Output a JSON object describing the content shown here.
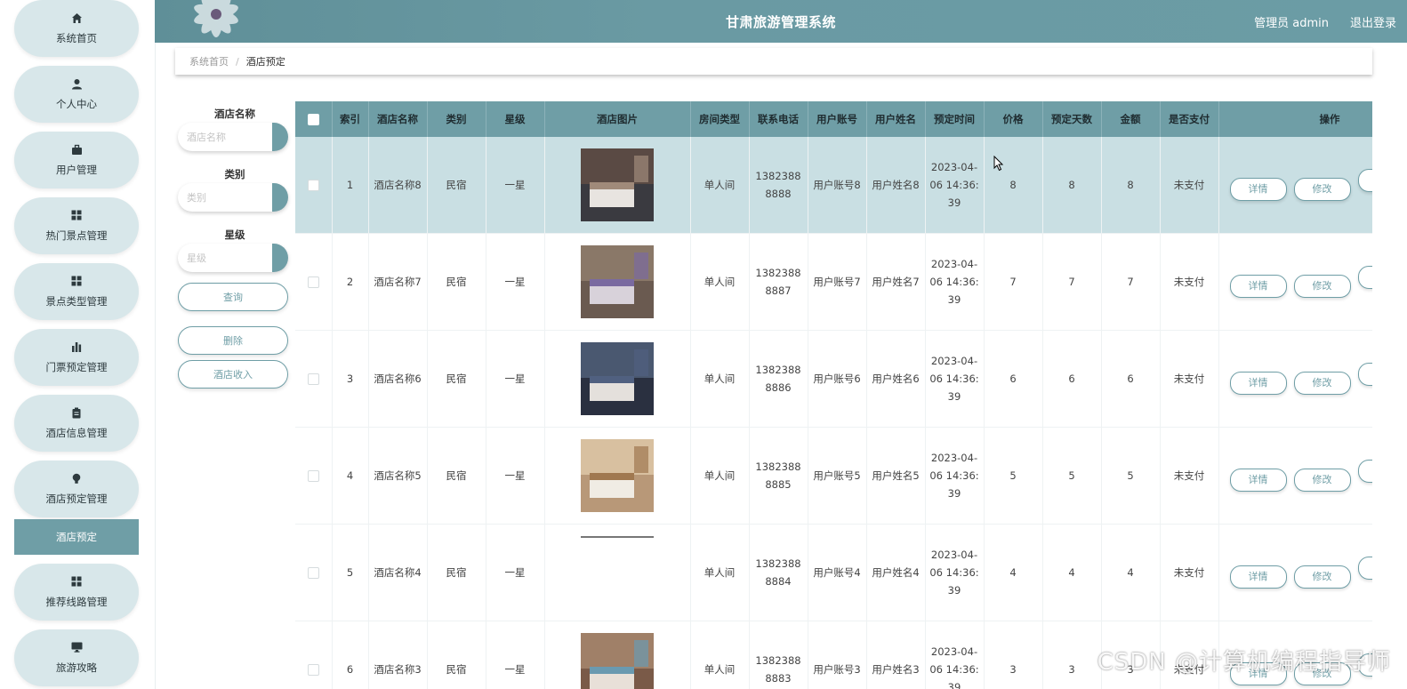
{
  "header": {
    "title": "甘肃旅游管理系统",
    "admin_text": "管理员 admin",
    "logout": "退出登录"
  },
  "sidebar": {
    "items": [
      {
        "label": "系统首页",
        "icon": "home-icon"
      },
      {
        "label": "个人中心",
        "icon": "user-icon"
      },
      {
        "label": "用户管理",
        "icon": "briefcase-icon"
      },
      {
        "label": "热门景点管理",
        "icon": "grid-icon"
      },
      {
        "label": "景点类型管理",
        "icon": "grid-icon"
      },
      {
        "label": "门票预定管理",
        "icon": "bar-chart-icon"
      },
      {
        "label": "酒店信息管理",
        "icon": "clipboard-icon"
      },
      {
        "label": "酒店预定管理",
        "icon": "bulb-icon"
      },
      {
        "label": "推荐线路管理",
        "icon": "grid-icon"
      },
      {
        "label": "旅游攻略",
        "icon": "monitor-icon"
      }
    ],
    "active_sub": "酒店预定"
  },
  "breadcrumb": {
    "home": "系统首页",
    "separator": "/",
    "current": "酒店预定"
  },
  "filter": {
    "name_label": "酒店名称",
    "name_placeholder": "酒店名称",
    "type_label": "类别",
    "type_placeholder": "类别",
    "star_label": "星级",
    "star_placeholder": "星级",
    "query_button": "查询",
    "delete_button": "删除",
    "income_button": "酒店收入"
  },
  "table": {
    "columns": [
      "索引",
      "酒店名称",
      "类别",
      "星级",
      "酒店图片",
      "房间类型",
      "联系电话",
      "用户账号",
      "用户姓名",
      "预定时间",
      "价格",
      "预定天数",
      "金额",
      "是否支付",
      "操作"
    ],
    "detail_label": "详情",
    "edit_label": "修改",
    "rows": [
      {
        "index": "1",
        "hotel_name": "酒店名称8",
        "category": "民宿",
        "star": "一星",
        "room_type": "单人间",
        "phone": "13823888888",
        "account": "用户账号8",
        "username": "用户姓名8",
        "time": "2023-04-06 14:36:39",
        "price": "8",
        "days": "8",
        "amount": "8",
        "paid": "未支付"
      },
      {
        "index": "2",
        "hotel_name": "酒店名称7",
        "category": "民宿",
        "star": "一星",
        "room_type": "单人间",
        "phone": "13823888887",
        "account": "用户账号7",
        "username": "用户姓名7",
        "time": "2023-04-06 14:36:39",
        "price": "7",
        "days": "7",
        "amount": "7",
        "paid": "未支付"
      },
      {
        "index": "3",
        "hotel_name": "酒店名称6",
        "category": "民宿",
        "star": "一星",
        "room_type": "单人间",
        "phone": "13823888886",
        "account": "用户账号6",
        "username": "用户姓名6",
        "time": "2023-04-06 14:36:39",
        "price": "6",
        "days": "6",
        "amount": "6",
        "paid": "未支付"
      },
      {
        "index": "4",
        "hotel_name": "酒店名称5",
        "category": "民宿",
        "star": "一星",
        "room_type": "单人间",
        "phone": "13823888885",
        "account": "用户账号5",
        "username": "用户姓名5",
        "time": "2023-04-06 14:36:39",
        "price": "5",
        "days": "5",
        "amount": "5",
        "paid": "未支付"
      },
      {
        "index": "5",
        "hotel_name": "酒店名称4",
        "category": "民宿",
        "star": "一星",
        "room_type": "单人间",
        "phone": "13823888884",
        "account": "用户账号4",
        "username": "用户姓名4",
        "time": "2023-04-06 14:36:39",
        "price": "4",
        "days": "4",
        "amount": "4",
        "paid": "未支付"
      },
      {
        "index": "6",
        "hotel_name": "酒店名称3",
        "category": "民宿",
        "star": "一星",
        "room_type": "单人间",
        "phone": "13823888883",
        "account": "用户账号3",
        "username": "用户姓名3",
        "time": "2023-04-06 14:36:39",
        "price": "3",
        "days": "3",
        "amount": "3",
        "paid": "未支付"
      }
    ]
  },
  "watermark": "CSDN @计算机编程指导师",
  "colors": {
    "accent": "#6f9ea6",
    "sidebar_item_bg": "#d8e7ea",
    "row_highlight": "#c9dfe3"
  }
}
